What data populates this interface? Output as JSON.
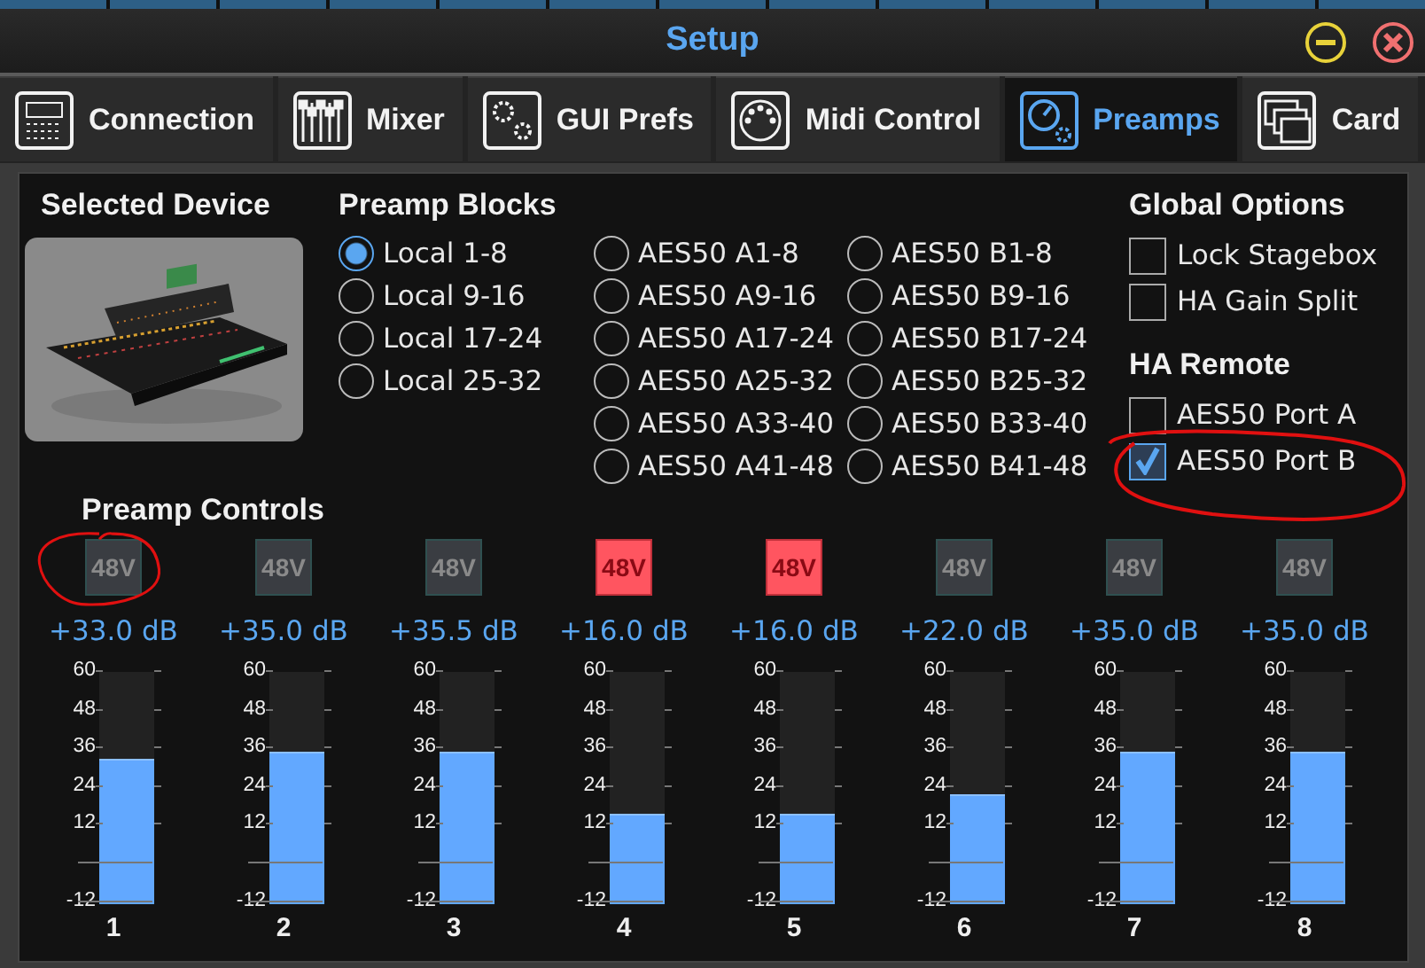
{
  "window": {
    "title": "Setup"
  },
  "tabs": [
    {
      "label": "Connection",
      "kind": "device",
      "selected": false
    },
    {
      "label": "Mixer",
      "kind": "faders",
      "selected": false
    },
    {
      "label": "GUI Prefs",
      "kind": "gears",
      "selected": false
    },
    {
      "label": "Midi Control",
      "kind": "midi",
      "selected": false
    },
    {
      "label": "Preamps",
      "kind": "knob",
      "selected": true
    },
    {
      "label": "Card",
      "kind": "cards",
      "selected": false
    }
  ],
  "selected_device": {
    "heading": "Selected Device"
  },
  "preamp_blocks": {
    "heading": "Preamp Blocks",
    "columns": [
      [
        {
          "label": "Local 1-8",
          "selected": true
        },
        {
          "label": "Local 9-16",
          "selected": false
        },
        {
          "label": "Local 17-24",
          "selected": false
        },
        {
          "label": "Local 25-32",
          "selected": false
        }
      ],
      [
        {
          "label": "AES50 A1-8",
          "selected": false
        },
        {
          "label": "AES50 A9-16",
          "selected": false
        },
        {
          "label": "AES50 A17-24",
          "selected": false
        },
        {
          "label": "AES50 A25-32",
          "selected": false
        },
        {
          "label": "AES50 A33-40",
          "selected": false
        },
        {
          "label": "AES50 A41-48",
          "selected": false
        }
      ],
      [
        {
          "label": "AES50 B1-8",
          "selected": false
        },
        {
          "label": "AES50 B9-16",
          "selected": false
        },
        {
          "label": "AES50 B17-24",
          "selected": false
        },
        {
          "label": "AES50 B25-32",
          "selected": false
        },
        {
          "label": "AES50 B33-40",
          "selected": false
        },
        {
          "label": "AES50 B41-48",
          "selected": false
        }
      ]
    ]
  },
  "global_options": {
    "heading": "Global Options",
    "items": [
      {
        "label": "Lock Stagebox",
        "checked": false
      },
      {
        "label": "HA Gain Split",
        "checked": false
      }
    ]
  },
  "ha_remote": {
    "heading": "HA Remote",
    "items": [
      {
        "label": "AES50 Port A",
        "checked": false
      },
      {
        "label": "AES50 Port B",
        "checked": true
      }
    ]
  },
  "preamp_controls": {
    "heading": "Preamp Controls",
    "channels": [
      {
        "phantom_label": "48V",
        "phantom_on": false,
        "gain": "+33.0 dB",
        "level": 0.625,
        "scale": [
          "60",
          "48",
          "36",
          "24",
          "12",
          "-12"
        ],
        "number": "1"
      },
      {
        "phantom_label": "48V",
        "phantom_on": false,
        "gain": "+35.0 dB",
        "level": 0.653,
        "scale": [
          "60",
          "48",
          "36",
          "24",
          "12",
          "-12"
        ],
        "number": "2"
      },
      {
        "phantom_label": "48V",
        "phantom_on": false,
        "gain": "+35.5 dB",
        "level": 0.66,
        "scale": [
          "60",
          "48",
          "36",
          "24",
          "12",
          "-12"
        ],
        "number": "3"
      },
      {
        "phantom_label": "48V",
        "phantom_on": true,
        "gain": "+16.0 dB",
        "level": 0.389,
        "scale": [
          "60",
          "48",
          "36",
          "24",
          "12",
          "-12"
        ],
        "number": "4"
      },
      {
        "phantom_label": "48V",
        "phantom_on": true,
        "gain": "+16.0 dB",
        "level": 0.389,
        "scale": [
          "60",
          "48",
          "36",
          "24",
          "12",
          "-12"
        ],
        "number": "5"
      },
      {
        "phantom_label": "48V",
        "phantom_on": false,
        "gain": "+22.0 dB",
        "level": 0.472,
        "scale": [
          "60",
          "48",
          "36",
          "24",
          "12",
          "-12"
        ],
        "number": "6"
      },
      {
        "phantom_label": "48V",
        "phantom_on": false,
        "gain": "+35.0 dB",
        "level": 0.653,
        "scale": [
          "60",
          "48",
          "36",
          "24",
          "12",
          "-12"
        ],
        "number": "7"
      },
      {
        "phantom_label": "48V",
        "phantom_on": false,
        "gain": "+35.0 dB",
        "level": 0.653,
        "scale": [
          "60",
          "48",
          "36",
          "24",
          "12",
          "-12"
        ],
        "number": "8"
      }
    ]
  }
}
